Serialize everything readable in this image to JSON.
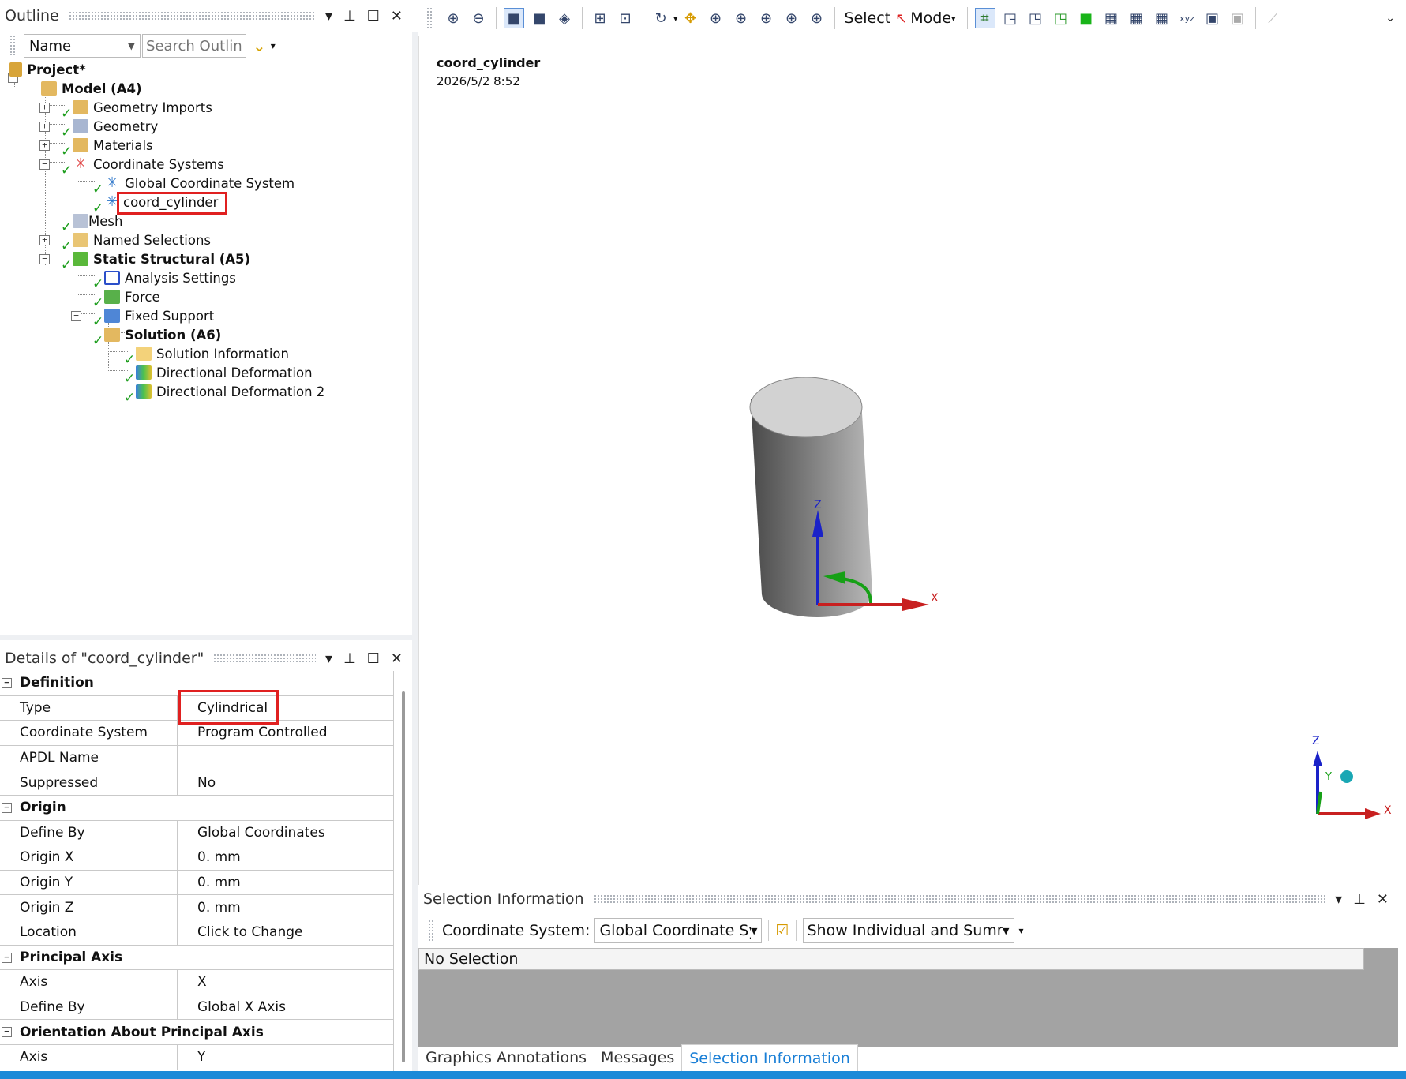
{
  "outline": {
    "title": "Outline",
    "filter_label": "Name",
    "search_placeholder": "Search Outline",
    "tree": [
      {
        "label": "Project*",
        "bold": true,
        "level": 0
      },
      {
        "label": "Model (A4)",
        "bold": true,
        "level": 1
      },
      {
        "label": "Geometry Imports",
        "level": 2
      },
      {
        "label": "Geometry",
        "level": 2
      },
      {
        "label": "Materials",
        "level": 2
      },
      {
        "label": "Coordinate Systems",
        "level": 2
      },
      {
        "label": "Global Coordinate System",
        "level": 3
      },
      {
        "label": "coord_cylinder",
        "level": 3,
        "selected": true
      },
      {
        "label": "Mesh",
        "level": 2
      },
      {
        "label": "Named Selections",
        "level": 2
      },
      {
        "label": "Static Structural (A5)",
        "bold": true,
        "level": 2
      },
      {
        "label": "Analysis Settings",
        "level": 3
      },
      {
        "label": "Force",
        "level": 3
      },
      {
        "label": "Fixed Support",
        "level": 3
      },
      {
        "label": "Solution (A6)",
        "bold": true,
        "level": 3
      },
      {
        "label": "Solution Information",
        "level": 4
      },
      {
        "label": "Directional Deformation",
        "level": 4
      },
      {
        "label": "Directional Deformation 2",
        "level": 4
      }
    ]
  },
  "details": {
    "title": "Details of \"coord_cylinder\"",
    "sections": [
      {
        "name": "Definition",
        "rows": [
          [
            "Type",
            "Cylindrical"
          ],
          [
            "Coordinate System",
            "Program Controlled"
          ],
          [
            "APDL Name",
            ""
          ],
          [
            "Suppressed",
            "No"
          ]
        ]
      },
      {
        "name": "Origin",
        "rows": [
          [
            "Define By",
            "Global Coordinates"
          ],
          [
            "Origin X",
            "0. mm"
          ],
          [
            "Origin Y",
            "0. mm"
          ],
          [
            "Origin Z",
            "0. mm"
          ],
          [
            "Location",
            "Click to Change"
          ]
        ]
      },
      {
        "name": "Principal Axis",
        "rows": [
          [
            "Axis",
            "X"
          ],
          [
            "Define By",
            "Global X Axis"
          ]
        ]
      },
      {
        "name": "Orientation About Principal Axis",
        "rows": [
          [
            "Axis",
            "Y"
          ]
        ]
      }
    ]
  },
  "toolbar": {
    "select_label": "Select",
    "mode_label": "Mode"
  },
  "viewport": {
    "object_name": "coord_cylinder",
    "date": "2026/5/2 8:52",
    "axis_x": "X",
    "axis_y": "Y",
    "axis_z": "Z"
  },
  "selection_info": {
    "title": "Selection Information",
    "coord_label": "Coordinate System:",
    "coord_value": "Global Coordinate Sy",
    "show_value": "Show Individual and Summa",
    "no_selection": "No Selection"
  },
  "bottom_tabs": [
    "Graphics Annotations",
    "Messages",
    "Selection Information"
  ],
  "colors": {
    "accent": "#1a7fd6",
    "highlight": "#e02020",
    "check": "#1e9e1e",
    "status": "#1c8ad8"
  }
}
